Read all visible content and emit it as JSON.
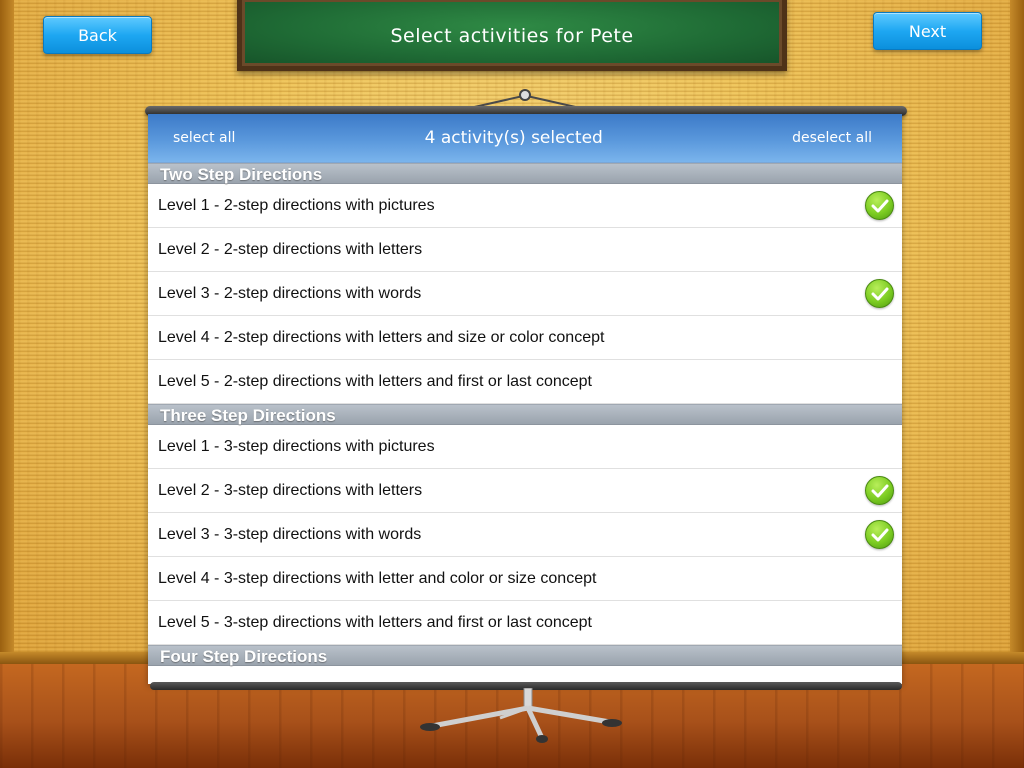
{
  "nav": {
    "back_label": "Back",
    "next_label": "Next"
  },
  "title": "Select activities for Pete",
  "list_header": {
    "select_all": "select all",
    "selected_count": "4 activity(s) selected",
    "deselect_all": "deselect all"
  },
  "sections": [
    {
      "title": "Two Step Directions",
      "items": [
        {
          "label": "Level 1 - 2-step directions with pictures",
          "selected": true
        },
        {
          "label": "Level 2 - 2-step directions with letters",
          "selected": false
        },
        {
          "label": "Level 3 - 2-step directions with words",
          "selected": true
        },
        {
          "label": "Level 4 - 2-step directions with letters and size or color concept",
          "selected": false
        },
        {
          "label": "Level 5 - 2-step directions with letters and first or last concept",
          "selected": false
        }
      ]
    },
    {
      "title": "Three Step Directions",
      "items": [
        {
          "label": "Level 1 - 3-step directions with pictures",
          "selected": false
        },
        {
          "label": "Level 2 - 3-step directions with letters",
          "selected": true
        },
        {
          "label": "Level 3 - 3-step directions with words",
          "selected": true
        },
        {
          "label": "Level 4 - 3-step directions with letter and color or size concept",
          "selected": false
        },
        {
          "label": "Level 5 - 3-step directions with letters and first or last concept",
          "selected": false
        }
      ]
    },
    {
      "title": "Four Step Directions",
      "items": []
    }
  ],
  "colors": {
    "header_blue": "#4a8ad2",
    "button_blue": "#1ea7f2",
    "check_green": "#7ccc22",
    "chalkboard_green": "#1f6b35"
  },
  "icons": {
    "selected": "checkmark-icon"
  }
}
